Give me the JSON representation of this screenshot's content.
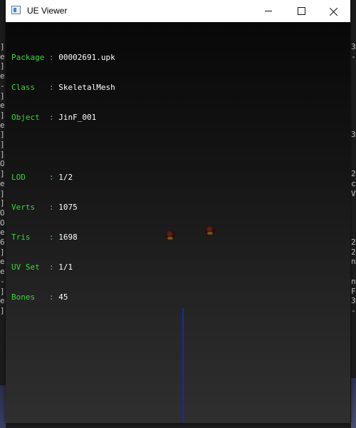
{
  "window": {
    "title": "UE Viewer",
    "controls": [
      "minimize",
      "maximize",
      "close"
    ]
  },
  "info_panel": {
    "rows": [
      {
        "key": "Package",
        "sep": ":",
        "value": "00002691.upk"
      },
      {
        "key": "Class  ",
        "sep": ":",
        "value": "SkeletalMesh"
      },
      {
        "key": "Object ",
        "sep": ":",
        "value": "JinF_001"
      },
      {
        "key": "LOD    ",
        "sep": ":",
        "value": "1/2"
      },
      {
        "key": "Verts  ",
        "sep": ":",
        "value": "1075"
      },
      {
        "key": "Tris   ",
        "sep": ":",
        "value": "1698"
      },
      {
        "key": "UV Set ",
        "sep": ":",
        "value": "1/1"
      },
      {
        "key": "Bones  ",
        "sep": ":",
        "value": "45"
      }
    ]
  },
  "background": {
    "left_chars": [
      "]",
      "e",
      "]",
      "e",
      "-",
      "]",
      "e",
      "]",
      "e",
      "]",
      "]",
      "]",
      "O",
      "]",
      "e",
      "]",
      "]",
      "O",
      "O",
      "e",
      "6",
      "]",
      "e",
      "e",
      "-",
      "]",
      "e",
      "]"
    ],
    "right_chars": [
      "3",
      "-",
      "",
      "",
      "",
      "",
      "",
      "",
      "",
      "3",
      "",
      "",
      "",
      "2",
      "c",
      "V",
      "",
      "",
      "",
      "",
      "2",
      "2",
      "n",
      "",
      "n",
      "F",
      "3",
      "-"
    ]
  },
  "colors": {
    "label_green": "#37d83a",
    "value_white": "#ffffff",
    "axis_blue": "#1a2aa0"
  }
}
